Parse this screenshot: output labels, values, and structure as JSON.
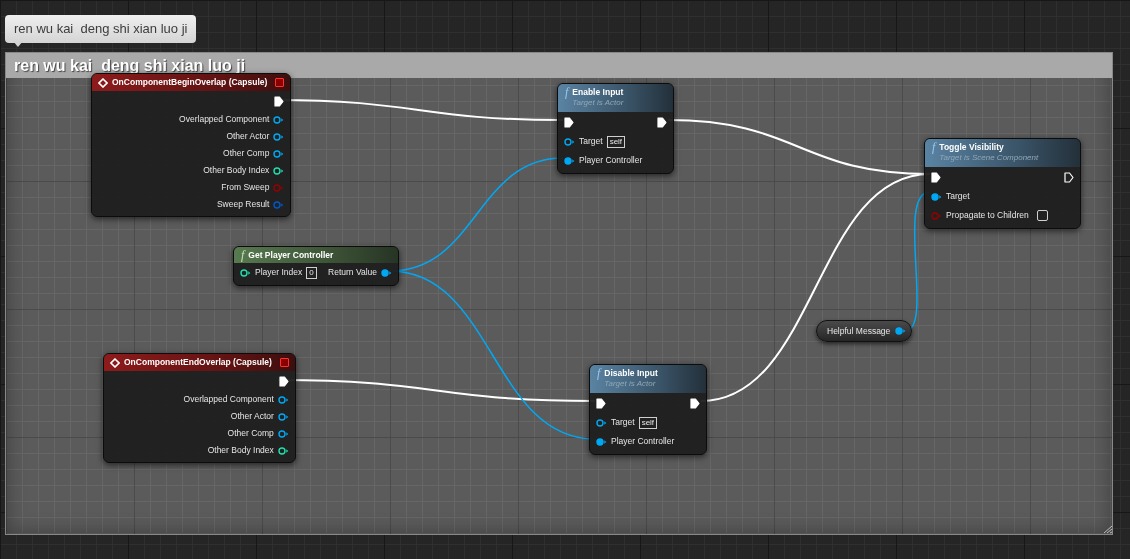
{
  "comment_bubble": "ren wu kai  deng shi xian luo ji",
  "comment_title": "ren wu kai  deng shi xian luo ji",
  "nodes": [
    {
      "kind": "event",
      "title": "OnComponentBeginOverlap (Capsule)",
      "exec_out": {
        "connected": true
      },
      "outputs": [
        {
          "kind": "object",
          "label": "Overlapped Component",
          "connected": false
        },
        {
          "kind": "object",
          "label": "Other Actor",
          "connected": false
        },
        {
          "kind": "object",
          "label": "Other Comp",
          "connected": false
        },
        {
          "kind": "int",
          "label": "Other Body Index",
          "connected": false
        },
        {
          "kind": "bool",
          "label": "From Sweep",
          "connected": false
        },
        {
          "kind": "struct",
          "label": "Sweep Result",
          "connected": false
        }
      ]
    },
    {
      "kind": "function",
      "icon_glyph": "f",
      "title": "Enable Input",
      "subtitle": "Target is Actor",
      "exec_in": {
        "connected": true
      },
      "exec_out": {
        "connected": true
      },
      "inputs": [
        {
          "kind": "object",
          "label": "Target",
          "default": "self",
          "connected": false
        },
        {
          "kind": "object",
          "label": "Player Controller",
          "connected": true
        }
      ]
    },
    {
      "kind": "pure",
      "icon_glyph": "f",
      "title": "Get Player Controller",
      "inputs": [
        {
          "kind": "int",
          "label": "Player Index",
          "default": "0",
          "connected": false
        }
      ],
      "outputs": [
        {
          "kind": "object",
          "label": "Return Value",
          "connected": true
        }
      ]
    },
    {
      "kind": "event",
      "title": "OnComponentEndOverlap (Capsule)",
      "exec_out": {
        "connected": true
      },
      "outputs": [
        {
          "kind": "object",
          "label": "Overlapped Component",
          "connected": false
        },
        {
          "kind": "object",
          "label": "Other Actor",
          "connected": false
        },
        {
          "kind": "object",
          "label": "Other Comp",
          "connected": false
        },
        {
          "kind": "int",
          "label": "Other Body Index",
          "connected": false
        }
      ]
    },
    {
      "kind": "function",
      "icon_glyph": "f",
      "title": "Disable Input",
      "subtitle": "Target is Actor",
      "exec_in": {
        "connected": true
      },
      "exec_out": {
        "connected": true
      },
      "inputs": [
        {
          "kind": "object",
          "label": "Target",
          "default": "self",
          "connected": false
        },
        {
          "kind": "object",
          "label": "Player Controller",
          "connected": true
        }
      ]
    },
    {
      "kind": "function",
      "icon_glyph": "f",
      "title": "Toggle Visibility",
      "subtitle": "Target is Scene Component",
      "exec_in": {
        "connected": true
      },
      "exec_out": {
        "connected": false
      },
      "inputs": [
        {
          "kind": "object",
          "label": "Target",
          "connected": true
        },
        {
          "kind": "bool",
          "label": "Propagate to Children",
          "connected": false,
          "checked": false
        }
      ]
    },
    {
      "kind": "variable",
      "title": "Helpful Message",
      "outputs": [
        {
          "kind": "object",
          "connected": true
        }
      ]
    }
  ]
}
